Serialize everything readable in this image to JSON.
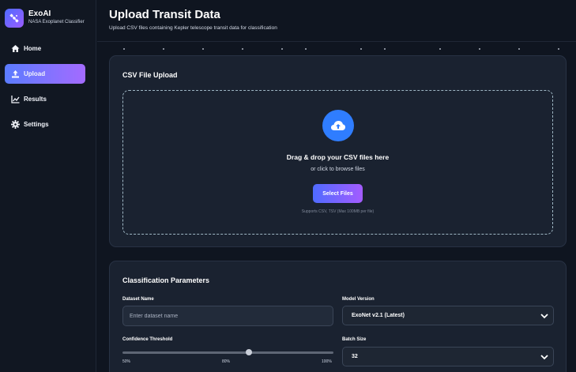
{
  "brand": {
    "name": "ExoAI",
    "subtitle": "NASA Exoplanet Classifier",
    "logo_icon": "satellite-icon"
  },
  "sidebar": {
    "items": [
      {
        "label": "Home",
        "icon": "home-icon",
        "active": false
      },
      {
        "label": "Upload",
        "icon": "upload-icon",
        "active": true
      },
      {
        "label": "Results",
        "icon": "chart-line-icon",
        "active": false
      },
      {
        "label": "Settings",
        "icon": "gear-icon",
        "active": false
      }
    ]
  },
  "header": {
    "title": "Upload Transit Data",
    "subtitle": "Upload CSV files containing Kepler telescope transit data for classification"
  },
  "upload": {
    "title": "CSV File Upload",
    "drop_main": "Drag & drop your CSV files here",
    "drop_alt": "or click to browse files",
    "button_label": "Select Files",
    "supports": "Supports CSV, TSV (Max 100MB per file)"
  },
  "params": {
    "title": "Classification Parameters",
    "dataset_name": {
      "label": "Dataset Name",
      "placeholder": "Enter dataset name",
      "value": ""
    },
    "model_version": {
      "label": "Model Version",
      "value": "ExoNet v2.1 (Latest)"
    },
    "confidence": {
      "label": "Confidence Threshold",
      "value": 0.8,
      "min_label": "50%",
      "mid_label": "80%",
      "max_label": "100%"
    },
    "batch_size": {
      "label": "Batch Size",
      "value": "32"
    }
  },
  "colors": {
    "accent_start": "#4f6bff",
    "accent_end": "#a45cff",
    "upload_circle": "#2f7dff",
    "background": "#0f1520"
  }
}
